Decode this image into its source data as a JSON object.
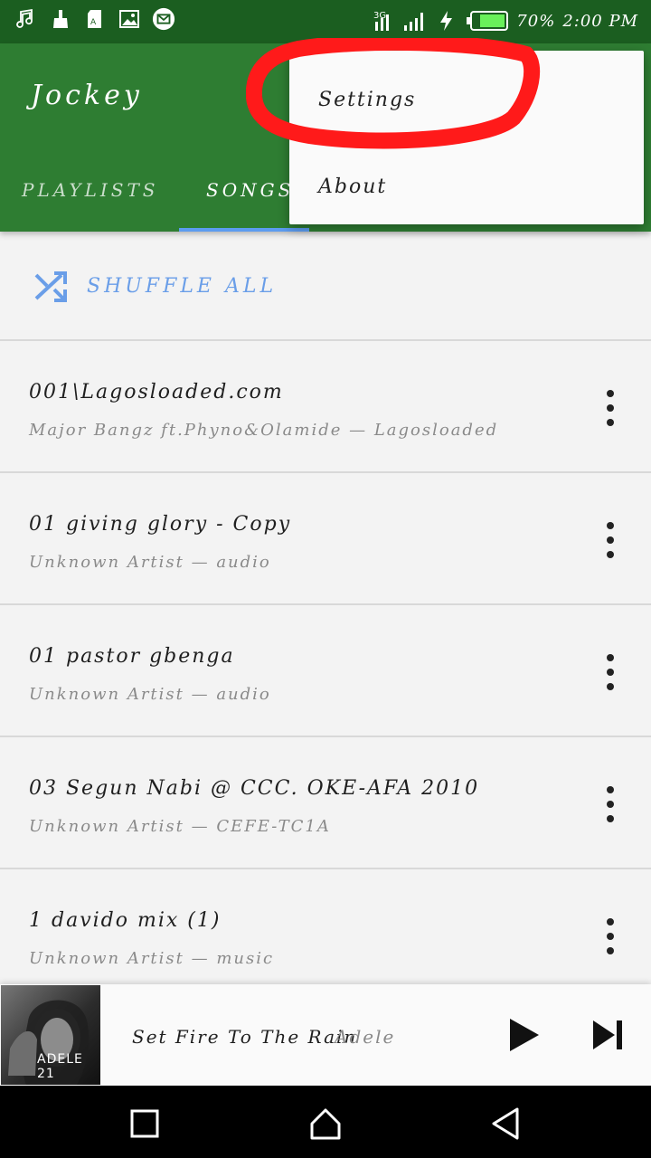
{
  "status_bar": {
    "battery": "70%",
    "time": "2:00 PM",
    "network": "3G",
    "icons": [
      "music-note-icon",
      "broom-icon",
      "sd-card-icon",
      "image-icon",
      "mail-icon",
      "signal-icon",
      "charging-icon",
      "battery-icon"
    ]
  },
  "app_bar": {
    "title": "Jockey",
    "tabs": [
      {
        "label": "PLAYLISTS",
        "active": false
      },
      {
        "label": "SONGS",
        "active": true
      }
    ]
  },
  "menu": {
    "items": [
      {
        "label": "Settings",
        "highlighted": true
      },
      {
        "label": "About",
        "highlighted": false
      }
    ]
  },
  "shuffle": {
    "label": "SHUFFLE ALL",
    "icon": "shuffle-icon"
  },
  "songs": [
    {
      "title": "001\\Lagosloaded.com",
      "subtitle": "Major Bangz ft.Phyno&Olamide — Lagosloaded"
    },
    {
      "title": "01 giving glory - Copy",
      "subtitle": "Unknown Artist — audio"
    },
    {
      "title": "01 pastor gbenga",
      "subtitle": "Unknown Artist — audio"
    },
    {
      "title": "03 Segun Nabi @ CCC. OKE-AFA 2010",
      "subtitle": "Unknown Artist — CEFE-TC1A"
    },
    {
      "title": "1 davido mix (1)",
      "subtitle": "Unknown Artist — music"
    }
  ],
  "now_playing": {
    "title": "Set Fire To The Rain",
    "artist": "Adele",
    "album_art_text": "ADELE 21"
  },
  "colors": {
    "status_bar": "#1b5e20",
    "app_bar": "#2e7d32",
    "accent": "#6a9ee8",
    "highlight_ring": "#ff1a1a"
  }
}
